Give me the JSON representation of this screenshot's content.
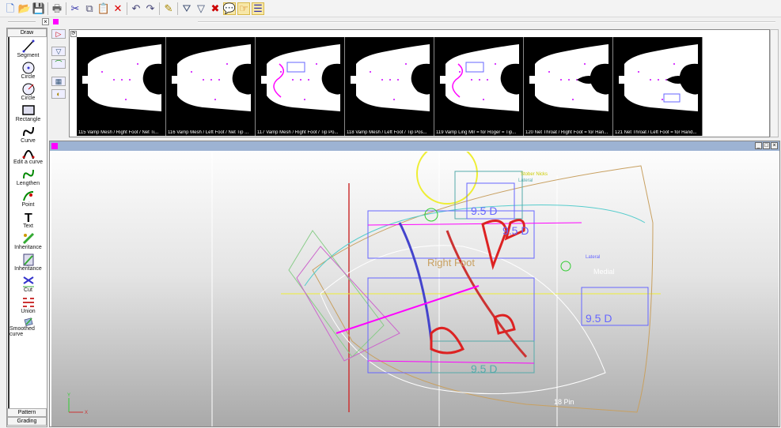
{
  "toolbar": {
    "buttons": [
      {
        "name": "new-file-icon",
        "glyph": "🗋"
      },
      {
        "name": "open-folder-icon",
        "glyph": "📂"
      },
      {
        "name": "save-icon",
        "glyph": "💾"
      },
      {
        "name": "print-icon",
        "glyph": "🖶"
      },
      {
        "name": "cut-icon",
        "glyph": "✂"
      },
      {
        "name": "copy-icon",
        "glyph": "⧉"
      },
      {
        "name": "paste-icon",
        "glyph": "📋"
      },
      {
        "name": "delete-icon",
        "glyph": "✕"
      },
      {
        "name": "undo-icon",
        "glyph": "↶"
      },
      {
        "name": "redo-icon",
        "glyph": "↷"
      },
      {
        "name": "properties-icon",
        "glyph": "✎"
      },
      {
        "name": "filter-apply-icon",
        "glyph": "⛛"
      },
      {
        "name": "filter-icon",
        "glyph": "▽"
      },
      {
        "name": "filter-clear-icon",
        "glyph": "✖"
      },
      {
        "name": "comment-icon",
        "glyph": "💬"
      },
      {
        "name": "pointer-icon",
        "glyph": "☞"
      },
      {
        "name": "layers-icon",
        "glyph": "☰"
      }
    ]
  },
  "subbar": {
    "close": "×"
  },
  "left_panel": {
    "header": "Draw",
    "tools": [
      "Segment",
      "Circle",
      "Circle",
      "Rectangle",
      "Curve",
      "Edit a curve",
      "Lengthen",
      "Point",
      "Text",
      "Inheritance",
      "Inheritance",
      "Cut",
      "Union",
      "Smoothed curve"
    ],
    "footer": [
      "Pattern",
      "Grading"
    ]
  },
  "thumbnails": [
    {
      "caption": "115  Vamp Mesh / Right Foot / Net Ti..."
    },
    {
      "caption": "116  Vamp Mesh / Left Foot / Net Tip ..."
    },
    {
      "caption": "117  Vamp Mesh / Right Foot / Tip Po..."
    },
    {
      "caption": "118  Vamp Mesh / Left Foot / Tip Pos..."
    },
    {
      "caption": "119  Vamp Ling Mlr = for Roger = Tip..."
    },
    {
      "caption": "120  Net Throat / Right Foot = for Han..."
    },
    {
      "caption": "121  Net Throat / Left Foot = for Hand..."
    }
  ],
  "drawing": {
    "labels": {
      "stober": "Stober Nicks",
      "lateral": "Lateral",
      "lateral2": "Lateral",
      "size1": "9.5 D",
      "size2": "9.5 D",
      "size3": "9.5 D",
      "size4": "9.5 D",
      "foot": "Right Foot",
      "medial": "Medial",
      "pin": "18 Pin",
      "axis_x": "X",
      "axis_y": "Y"
    }
  },
  "window": {
    "min": "_",
    "max": "□",
    "close": "×"
  },
  "colors": {
    "accent": "#ff00ff",
    "title": "#9db3d3"
  }
}
